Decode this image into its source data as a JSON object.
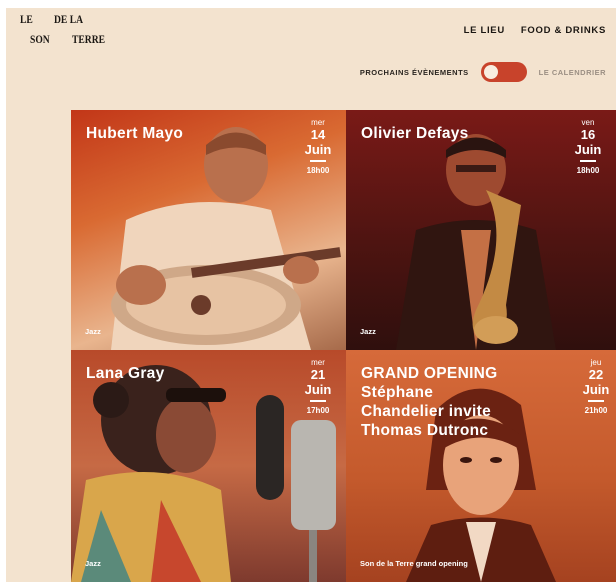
{
  "logo": {
    "l1": "LE",
    "l2": "DE LA",
    "l3": "SON",
    "l4": "TERRE"
  },
  "nav": {
    "lieu": "LE LIEU",
    "food": "FOOD & DRINKS"
  },
  "toggle": {
    "left_label": "PROCHAINS ÉVÈNEMENTS",
    "right_label": "LE CALENDRIER"
  },
  "events": [
    {
      "title": "Hubert Mayo",
      "day": "mer",
      "num": "14",
      "month": "Juin",
      "time": "18h00",
      "tag": "Jazz"
    },
    {
      "title": "Olivier Defays",
      "day": "ven",
      "num": "16",
      "month": "Juin",
      "time": "18h00",
      "tag": "Jazz"
    },
    {
      "title": "Lana Gray",
      "day": "mer",
      "num": "21",
      "month": "Juin",
      "time": "17h00",
      "tag": "Jazz"
    },
    {
      "title_lines": [
        "GRAND OPENING",
        "Stéphane",
        "Chandelier invite",
        "Thomas Dutronc"
      ],
      "day": "jeu",
      "num": "22",
      "month": "Juin",
      "time": "21h00",
      "tag": "Son de la Terre grand opening"
    }
  ],
  "colors": {
    "background": "#f3e3cf",
    "accent": "#c8432b"
  }
}
